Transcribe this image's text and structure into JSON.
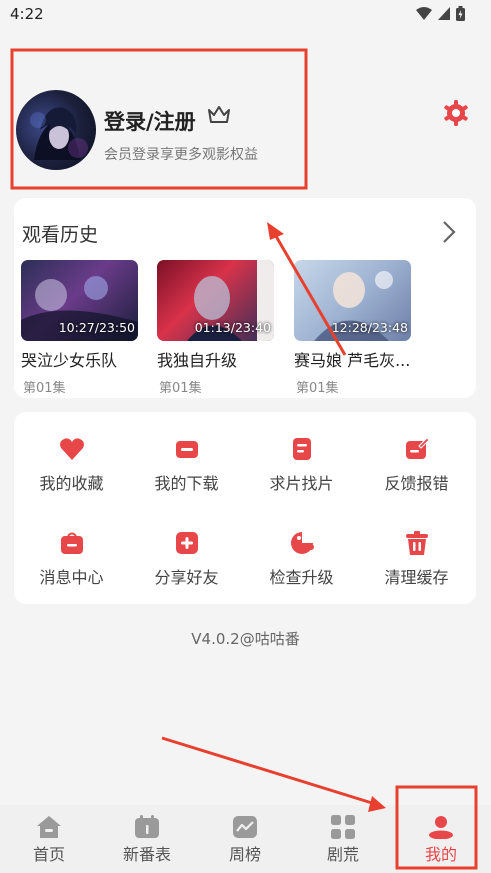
{
  "status_bar": {
    "time": "4:22"
  },
  "profile": {
    "title": "登录/注册",
    "subtitle": "会员登录享更多观影权益"
  },
  "history": {
    "title": "观看历史",
    "items": [
      {
        "title": "哭泣少女乐队",
        "time": "10:27/23:50",
        "episode": "第01集"
      },
      {
        "title": "我独自升级",
        "time": "01:13/23:40",
        "episode": "第01集"
      },
      {
        "title": "赛马娘 芦毛灰...",
        "time": "12:28/23:48",
        "episode": "第01集"
      }
    ]
  },
  "menu": {
    "items": [
      {
        "label": "我的收藏",
        "icon": "heart-icon"
      },
      {
        "label": "我的下载",
        "icon": "download-icon"
      },
      {
        "label": "求片找片",
        "icon": "request-icon"
      },
      {
        "label": "反馈报错",
        "icon": "feedback-icon"
      },
      {
        "label": "消息中心",
        "icon": "message-icon"
      },
      {
        "label": "分享好友",
        "icon": "share-icon"
      },
      {
        "label": "检查升级",
        "icon": "upgrade-icon"
      },
      {
        "label": "清理缓存",
        "icon": "trash-icon"
      }
    ]
  },
  "version": "V4.0.2@咕咕番",
  "bottom_nav": {
    "items": [
      {
        "label": "首页",
        "icon": "home-icon"
      },
      {
        "label": "新番表",
        "icon": "calendar-icon"
      },
      {
        "label": "周榜",
        "icon": "chart-icon"
      },
      {
        "label": "剧荒",
        "icon": "grid-icon"
      },
      {
        "label": "我的",
        "icon": "user-icon",
        "active": true
      }
    ]
  },
  "colors": {
    "accent": "#e8474a",
    "annotation": "#e8402e"
  }
}
